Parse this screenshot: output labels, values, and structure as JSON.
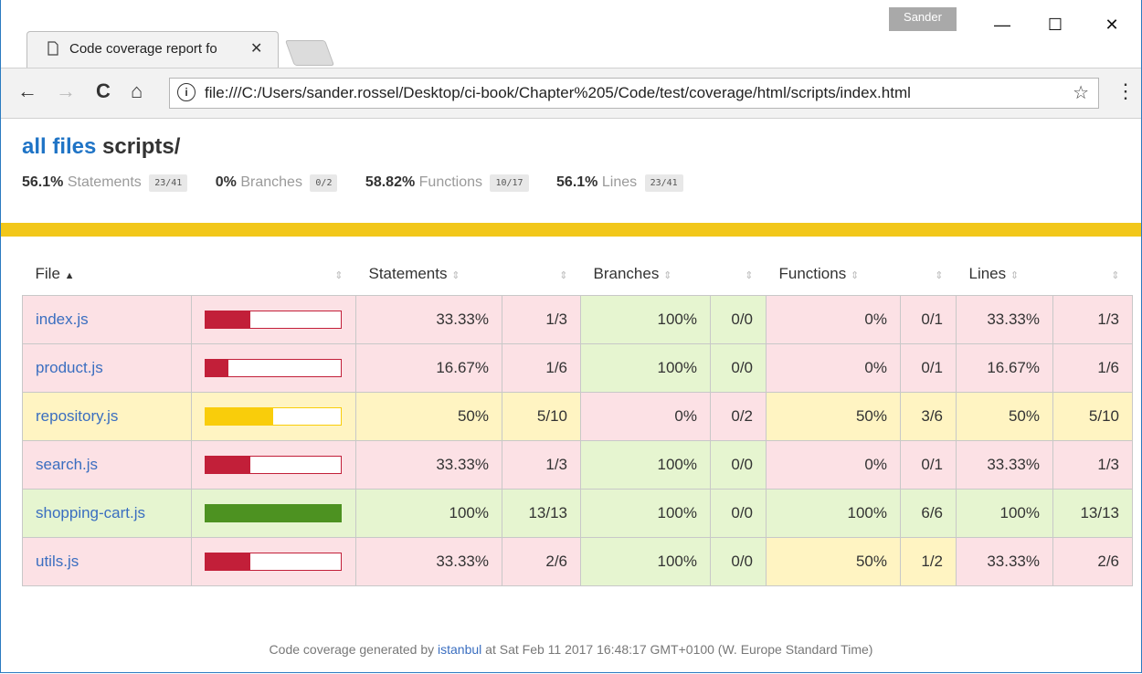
{
  "browser": {
    "user_badge": "Sander",
    "minimize": "—",
    "maximize": "☐",
    "close": "✕",
    "tab_title": "Code coverage report fo",
    "tab_close": "✕",
    "url": "file:///C:/Users/sander.rossel/Desktop/ci-book/Chapter%205/Code/test/coverage/html/scripts/index.html",
    "back": "←",
    "forward": "→",
    "reload": "C",
    "home": "⌂",
    "info": "i",
    "star": "☆",
    "menu": "⋮"
  },
  "header": {
    "root_link": "all files",
    "folder": "scripts/"
  },
  "summary": [
    {
      "pct": "56.1%",
      "label": "Statements",
      "frac": "23/41"
    },
    {
      "pct": "0%",
      "label": "Branches",
      "frac": "0/2"
    },
    {
      "pct": "58.82%",
      "label": "Functions",
      "frac": "10/17"
    },
    {
      "pct": "56.1%",
      "label": "Lines",
      "frac": "23/41"
    }
  ],
  "colors": {
    "low_bg": "#fce1e5",
    "medium_bg": "#fff4c2",
    "high_bg": "#e6f5d0",
    "low_fill": "#c21f39",
    "medium_fill": "#f9cd0b",
    "high_fill": "#4d9221",
    "status_bar": "#f2c71a"
  },
  "table": {
    "headers": {
      "file": "File",
      "statements": "Statements",
      "branches": "Branches",
      "functions": "Functions",
      "lines": "Lines",
      "sort_active": "▲",
      "sort_idle": "⇕"
    },
    "rows": [
      {
        "file": "index.js",
        "coverage": 0.3333,
        "level": "low",
        "stmt_pct": "33.33%",
        "stmt_frac": "1/3",
        "stmt_level": "low",
        "branch_pct": "100%",
        "branch_frac": "0/0",
        "branch_level": "high",
        "func_pct": "0%",
        "func_frac": "0/1",
        "func_level": "low",
        "line_pct": "33.33%",
        "line_frac": "1/3",
        "line_level": "low"
      },
      {
        "file": "product.js",
        "coverage": 0.1667,
        "level": "low",
        "stmt_pct": "16.67%",
        "stmt_frac": "1/6",
        "stmt_level": "low",
        "branch_pct": "100%",
        "branch_frac": "0/0",
        "branch_level": "high",
        "func_pct": "0%",
        "func_frac": "0/1",
        "func_level": "low",
        "line_pct": "16.67%",
        "line_frac": "1/6",
        "line_level": "low"
      },
      {
        "file": "repository.js",
        "coverage": 0.5,
        "level": "medium",
        "stmt_pct": "50%",
        "stmt_frac": "5/10",
        "stmt_level": "medium",
        "branch_pct": "0%",
        "branch_frac": "0/2",
        "branch_level": "low",
        "func_pct": "50%",
        "func_frac": "3/6",
        "func_level": "medium",
        "line_pct": "50%",
        "line_frac": "5/10",
        "line_level": "medium"
      },
      {
        "file": "search.js",
        "coverage": 0.3333,
        "level": "low",
        "stmt_pct": "33.33%",
        "stmt_frac": "1/3",
        "stmt_level": "low",
        "branch_pct": "100%",
        "branch_frac": "0/0",
        "branch_level": "high",
        "func_pct": "0%",
        "func_frac": "0/1",
        "func_level": "low",
        "line_pct": "33.33%",
        "line_frac": "1/3",
        "line_level": "low"
      },
      {
        "file": "shopping-cart.js",
        "coverage": 1.0,
        "level": "high",
        "stmt_pct": "100%",
        "stmt_frac": "13/13",
        "stmt_level": "high",
        "branch_pct": "100%",
        "branch_frac": "0/0",
        "branch_level": "high",
        "func_pct": "100%",
        "func_frac": "6/6",
        "func_level": "high",
        "line_pct": "100%",
        "line_frac": "13/13",
        "line_level": "high"
      },
      {
        "file": "utils.js",
        "coverage": 0.3333,
        "level": "low",
        "stmt_pct": "33.33%",
        "stmt_frac": "2/6",
        "stmt_level": "low",
        "branch_pct": "100%",
        "branch_frac": "0/0",
        "branch_level": "high",
        "func_pct": "50%",
        "func_frac": "1/2",
        "func_level": "medium",
        "line_pct": "33.33%",
        "line_frac": "2/6",
        "line_level": "low"
      }
    ]
  },
  "footer": {
    "prefix": "Code coverage generated by",
    "tool": "istanbul",
    "suffix": "at Sat Feb 11 2017 16:48:17 GMT+0100 (W. Europe Standard Time)"
  }
}
